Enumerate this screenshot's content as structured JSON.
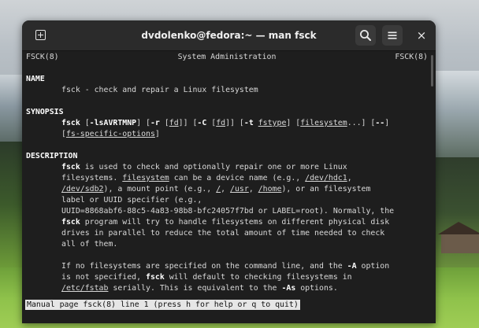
{
  "window": {
    "title": "dvdolenko@fedora:~ — man fsck",
    "new_tab_icon": "new-tab-icon",
    "search_icon": "search-icon",
    "menu_icon": "hamburger-menu-icon",
    "close_label": "×"
  },
  "man": {
    "header_left": "FSCK(8)",
    "header_center": "System Administration",
    "header_right": "FSCK(8)",
    "name_heading": "NAME",
    "name_text": "fsck - check and repair a Linux filesystem",
    "synopsis_heading": "SYNOPSIS",
    "syn1_cmd": "fsck",
    "syn1_a": " [",
    "syn1_opt": "-lsAVRTMNP",
    "syn1_b": "] [",
    "syn1_r": "-r",
    "syn1_c": " [",
    "syn1_fd1": "fd",
    "syn1_d": "]] [",
    "syn1_C": "-C",
    "syn1_e": " [",
    "syn1_fd2": "fd",
    "syn1_f": "]] [",
    "syn1_t": "-t",
    "syn1_g": " ",
    "syn1_fstype": "fstype",
    "syn1_h": "] [",
    "syn1_fs": "filesystem",
    "syn1_i": "...] [",
    "syn1_dd": "--",
    "syn1_j": "]",
    "syn2_a": "[",
    "syn2_opts": "fs-specific-options",
    "syn2_b": "]",
    "description_heading": "DESCRIPTION",
    "d1_cmd": "fsck",
    "d1_rest": " is used to check and optionally repair one or more Linux",
    "d2_a": "filesystems. ",
    "d2_fs": "filesystem",
    "d2_b": " can be a device name (e.g., ",
    "d2_dev": "/dev/hdc1",
    "d2_c": ",",
    "d3_dev": "/dev/sdb2",
    "d3_a": "), a mount point (e.g., ",
    "d3_root": "/",
    "d3_b": ", ",
    "d3_usr": "/usr",
    "d3_c": ", ",
    "d3_home": "/home",
    "d3_d": "), or an filesystem",
    "d4": "label or UUID specifier (e.g.,",
    "d5": "UUID=8868abf6-88c5-4a83-98b8-bfc24057f7bd or LABEL=root). Normally, the",
    "d6_cmd": "fsck",
    "d6_rest": " program will try to handle filesystems on different physical disk",
    "d7": "drives in parallel to reduce the total amount of time needed to check",
    "d8": "all of them.",
    "p2_1a": "If no filesystems are specified on the command line, and the ",
    "p2_1A": "-A",
    "p2_1b": " option",
    "p2_2a": "is not specified, ",
    "p2_2cmd": "fsck",
    "p2_2b": " will default to checking filesystems in",
    "p2_3path": "/etc/fstab",
    "p2_3a": " serially. This is equivalent to the ",
    "p2_3As": "-As",
    "p2_3b": " options.",
    "status_line": "Manual page fsck(8) line 1 (press h for help or q to quit)"
  }
}
